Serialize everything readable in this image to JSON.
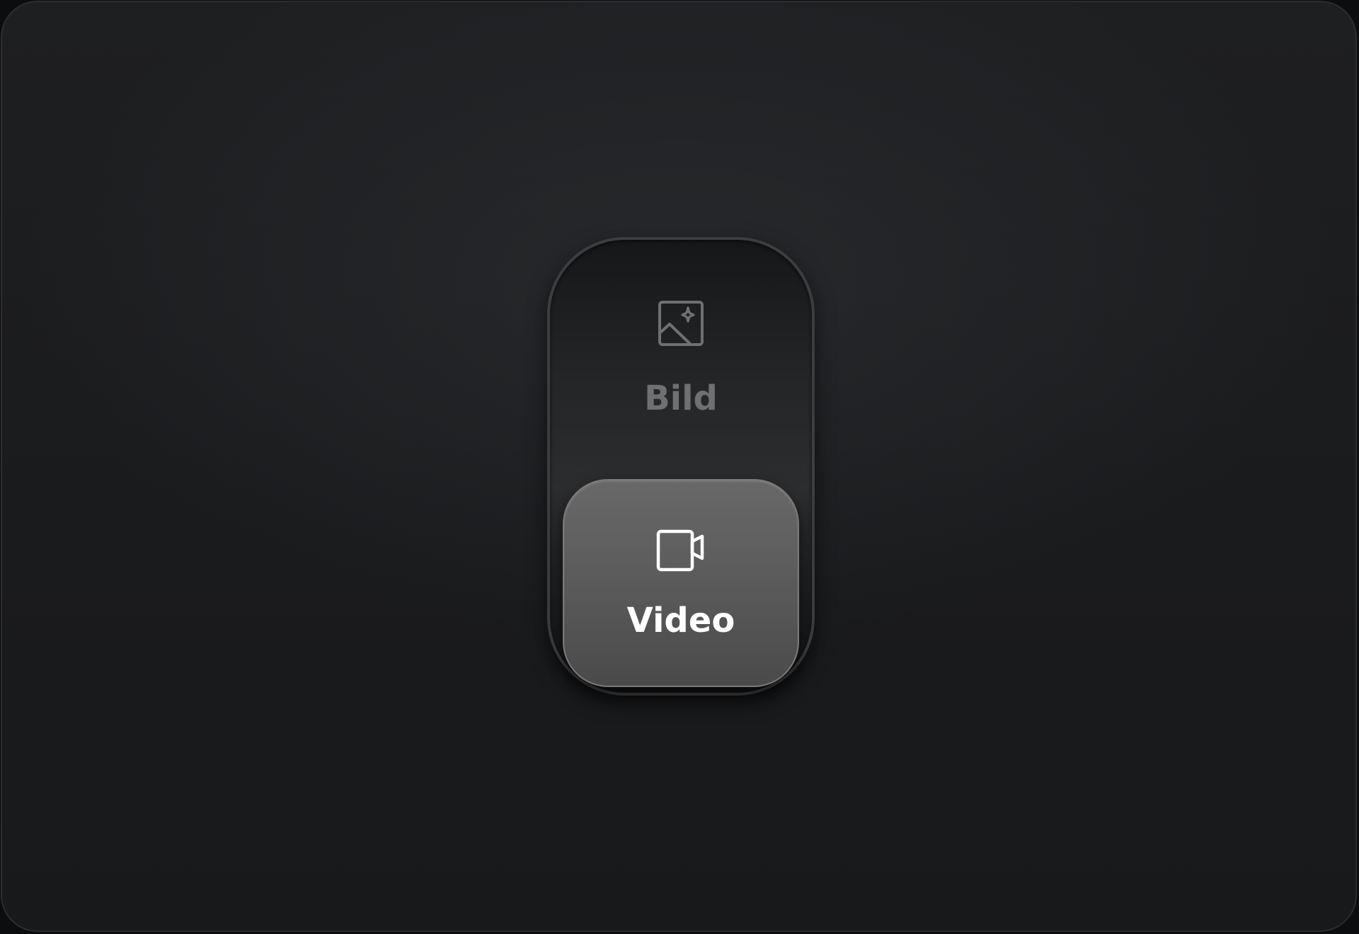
{
  "segmented_control": {
    "options": [
      {
        "label": "Bild",
        "icon": "image-sparkle-icon",
        "selected": false
      },
      {
        "label": "Video",
        "icon": "video-camera-icon",
        "selected": true
      }
    ]
  },
  "colors": {
    "background": "#1b1c1e",
    "track_border": "#3c3d40",
    "selected_pill": "#5c5c5c",
    "inactive_text": "#6f7072",
    "active_text": "#ffffff"
  }
}
